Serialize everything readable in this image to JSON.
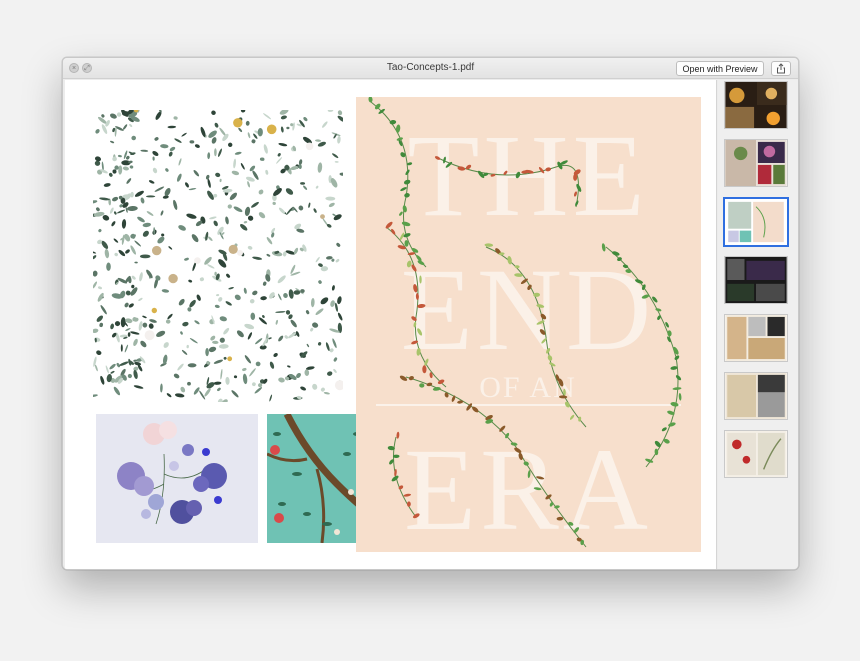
{
  "window": {
    "title": "Tao-Concepts-1.pdf",
    "open_with_label": "Open with Preview"
  },
  "poster": {
    "line1": "THE",
    "line2": "END",
    "line3": "OF AN",
    "line4": "ERA"
  },
  "sidebar": {
    "selected_index": 2,
    "thumbnails": [
      {
        "name": "page-1"
      },
      {
        "name": "page-2"
      },
      {
        "name": "page-3"
      },
      {
        "name": "page-4"
      },
      {
        "name": "page-5"
      },
      {
        "name": "page-6"
      },
      {
        "name": "page-7"
      }
    ]
  },
  "colors": {
    "poster_bg": "#f7dfcc",
    "leaf_dark": "#3f5a4a",
    "leaf_green": "#5aa04a",
    "leaf_red": "#c4583a",
    "selection_blue": "#2f6fe0",
    "teal": "#6fc2b4",
    "lavender": "#e7e7f2"
  }
}
